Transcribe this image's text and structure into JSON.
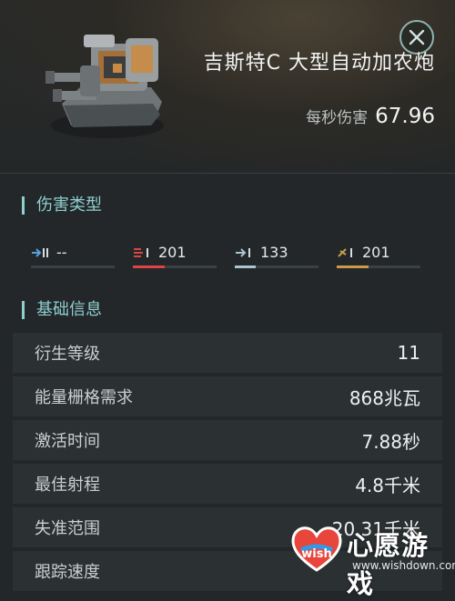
{
  "item": {
    "name": "吉斯特C 大型自动加农炮",
    "dps_label": "每秒伤害",
    "dps_value": "67.96"
  },
  "damage_section": {
    "title": "伤害类型",
    "types": [
      {
        "icon": "em-damage-icon",
        "value": "--",
        "color": "#5aa0e0",
        "fill": 0
      },
      {
        "icon": "thermal-damage-icon",
        "value": "201",
        "color": "#d94444",
        "fill": 0.38
      },
      {
        "icon": "kinetic-damage-icon",
        "value": "133",
        "color": "#a9c4d3",
        "fill": 0.25
      },
      {
        "icon": "explosive-damage-icon",
        "value": "201",
        "color": "#c99a4a",
        "fill": 0.38
      }
    ]
  },
  "info_section": {
    "title": "基础信息",
    "rows": [
      {
        "key": "衍生等级",
        "value": "11"
      },
      {
        "key": "能量栅格需求",
        "value": "868兆瓦"
      },
      {
        "key": "激活时间",
        "value": "7.88秒"
      },
      {
        "key": "最佳射程",
        "value": "4.8千米"
      },
      {
        "key": "失准范围",
        "value": "20.31千米"
      },
      {
        "key": "跟踪速度",
        "value": ""
      }
    ]
  },
  "watermark": {
    "text": "心愿游戏",
    "url": "www.wishdown.com",
    "logo_text": "wish"
  },
  "colors": {
    "accent": "#8ecfcf",
    "background": "#232729",
    "row_background": "#2b3032"
  }
}
